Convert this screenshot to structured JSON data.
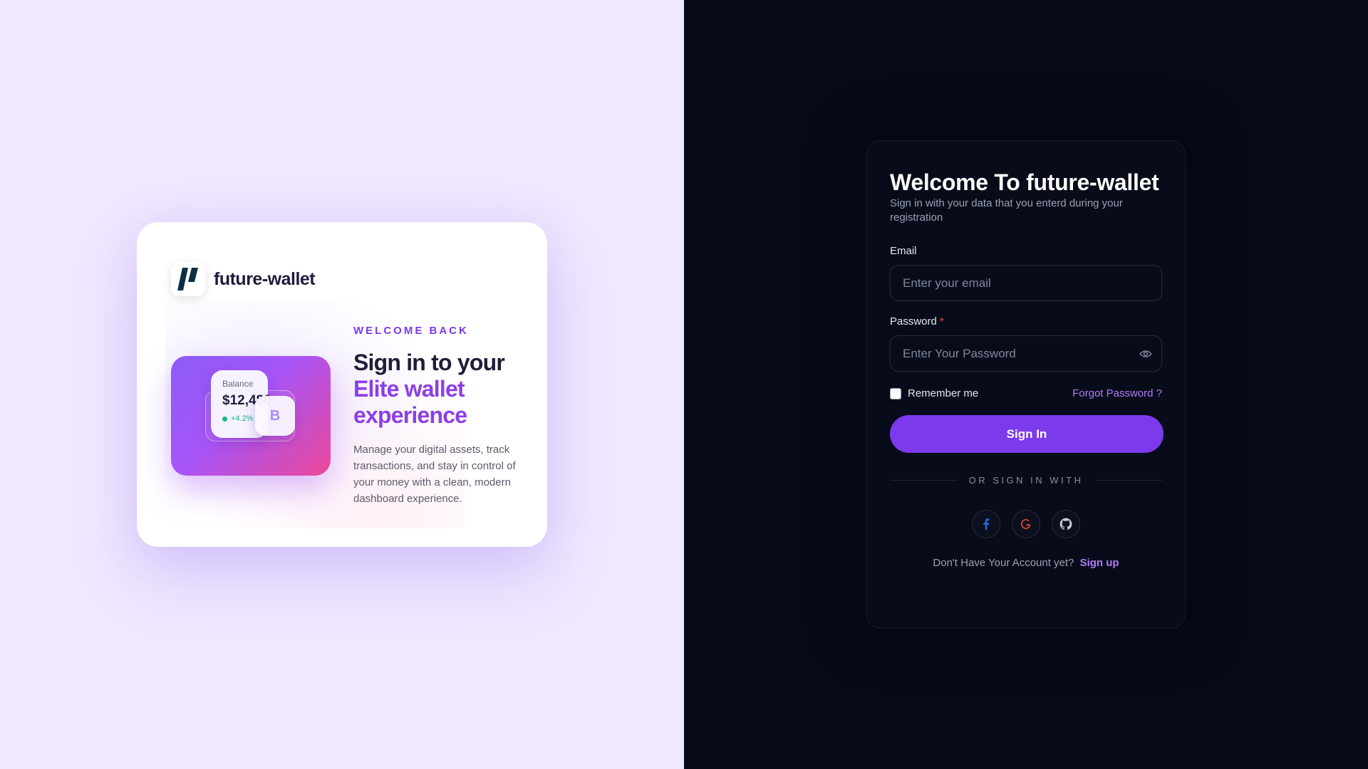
{
  "brand": {
    "name": "future-wallet",
    "logo_icon": "slash-logo-icon"
  },
  "promo": {
    "eyebrow": "WELCOME BACK",
    "headline_line1": "Sign in to your",
    "headline_accent": "Elite wallet experience",
    "description": "Manage your digital assets, track transactions, and stay in control of your money with a clean, modern dashboard experience.",
    "balance_label": "Balance",
    "balance_value": "$12,480",
    "balance_change": "+4.2%",
    "coin_symbol": "B"
  },
  "signin": {
    "title": "Welcome To future-wallet",
    "subtitle": "Sign in with your data that you enterd during your registration",
    "email_label": "Email",
    "email_placeholder": "Enter your email",
    "password_label": "Password",
    "password_required_mark": "*",
    "password_placeholder": "Enter Your Password",
    "remember_label": "Remember me",
    "forgot_label": "Forgot Password ?",
    "submit_label": "Sign In",
    "divider_label": "OR SIGN IN WITH",
    "socials": [
      "facebook-icon",
      "google-icon",
      "github-icon"
    ],
    "no_account_text": "Don't Have Your Account yet?",
    "signup_label": "Sign up"
  },
  "colors": {
    "left_bg": "#f0e8fe",
    "right_bg": "#070a18",
    "accent": "#7c3aed",
    "link": "#b07cf8",
    "positive": "#10b981",
    "required": "#ef4444"
  }
}
